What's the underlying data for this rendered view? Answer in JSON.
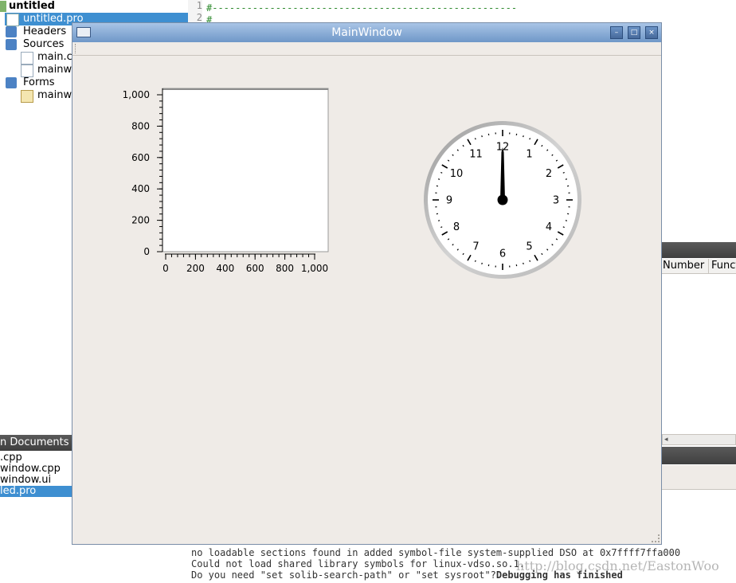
{
  "project_tree": {
    "items": [
      {
        "label": "untitled",
        "bold": true
      },
      {
        "label": "untitled.pro",
        "selected": true
      },
      {
        "label": "Headers"
      },
      {
        "label": "Sources"
      },
      {
        "label": "main.cp"
      },
      {
        "label": "mainwi"
      },
      {
        "label": "Forms"
      },
      {
        "label": "mainwi"
      }
    ]
  },
  "editor": {
    "line_numbers": [
      "1",
      "2"
    ],
    "lines": [
      "#-----------------------------------------------------",
      "#"
    ]
  },
  "open_documents": {
    "title": "n Documents",
    "items": [
      {
        "label": ".cpp"
      },
      {
        "label": "window.cpp"
      },
      {
        "label": "window.ui"
      },
      {
        "label": "led.pro",
        "selected": true
      }
    ]
  },
  "right_panel": {
    "columns": [
      "Number",
      "Functi"
    ]
  },
  "output": {
    "lines": [
      "no loadable sections found in added symbol-file system-supplied DSO at 0x7ffff7ffa000",
      "Could not load shared library symbols for linux-vdso.so.1.",
      "Do you need \"set solib-search-path\" or \"set sysroot\"?"
    ],
    "finished": "Debugging has finished",
    "watermark": "http://blog.csdn.net/EastonWoo"
  },
  "main_window": {
    "title": "MainWindow",
    "buttons": {
      "minimize": "–",
      "maximize": "□",
      "close": "×"
    }
  },
  "chart_data": {
    "type": "scatter",
    "x": [],
    "y": [],
    "xlim": [
      0,
      1000
    ],
    "ylim": [
      0,
      1000
    ],
    "xticks": [
      "0",
      "200",
      "400",
      "600",
      "800",
      "1,000"
    ],
    "yticks": [
      "0",
      "200",
      "400",
      "600",
      "800",
      "1,000"
    ],
    "title": "",
    "xlabel": "",
    "ylabel": ""
  },
  "clock": {
    "numbers": [
      "12",
      "1",
      "2",
      "3",
      "4",
      "5",
      "6",
      "7",
      "8",
      "9",
      "10",
      "11"
    ],
    "hand_hour": 12
  }
}
